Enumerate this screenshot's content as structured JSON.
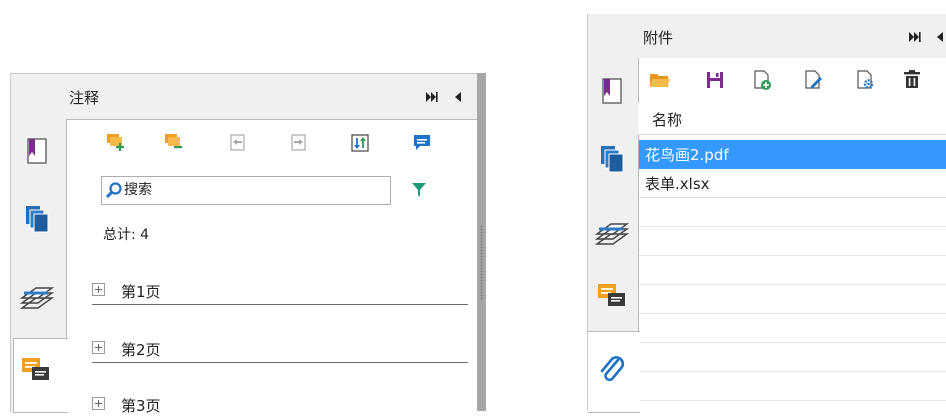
{
  "annotations_panel": {
    "title": "注释",
    "search": {
      "placeholder": "搜索",
      "value": "搜索"
    },
    "total_label": "总计: 4",
    "pages": [
      {
        "label": "第1页"
      },
      {
        "label": "第2页"
      },
      {
        "label": "第3页"
      }
    ],
    "toolbar": [
      "expand-all-icon",
      "collapse-all-icon",
      "import-icon",
      "export-icon",
      "sort-icon",
      "comment-icon"
    ],
    "filter_icon": "filter-icon",
    "side_tabs": [
      "bookmark-icon",
      "pages-icon",
      "layers-icon",
      "comments-icon"
    ]
  },
  "attachments_panel": {
    "title": "附件",
    "column_header": "名称",
    "files": [
      {
        "name": "花鸟画2.pdf",
        "selected": true
      },
      {
        "name": "表单.xlsx",
        "selected": false
      }
    ],
    "toolbar": [
      "open-icon",
      "save-icon",
      "add-file-icon",
      "edit-icon",
      "properties-icon",
      "delete-icon"
    ],
    "side_tabs": [
      "bookmark-icon",
      "pages-icon",
      "layers-icon",
      "comments-icon",
      "attachment-icon"
    ]
  },
  "colors": {
    "selection": "#3399ff",
    "accent_orange": "#f0a020",
    "accent_green": "#2e9a5a",
    "accent_purple": "#7b2d8e",
    "accent_blue": "#1f73c4",
    "filter_teal": "#1f9a7a"
  }
}
